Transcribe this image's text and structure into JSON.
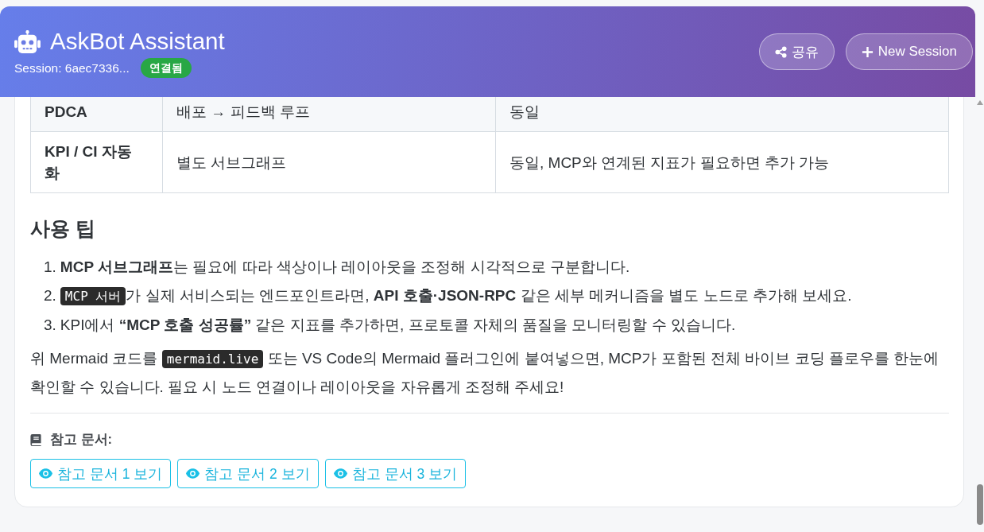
{
  "header": {
    "title": "AskBot Assistant",
    "session": "Session: 6aec7336...",
    "status_badge": {
      "label": "연결됨",
      "connected": true
    },
    "buttons": [
      {
        "kind": "share",
        "label": "공유"
      },
      {
        "kind": "new",
        "label": "New Session"
      }
    ]
  },
  "message": {
    "table": {
      "rows": [
        {
          "cells": [
            "PDCA",
            "배포 → 피드백 루프",
            "동일"
          ]
        },
        {
          "cells": [
            "KPI / CI 자동화",
            "별도 서브그래프",
            "동일, MCP와 연계된 지표가 필요하면 추가 가능"
          ]
        }
      ]
    },
    "heading": "사용 팁",
    "tips": [
      {
        "number": "1.",
        "segments": [
          {
            "kind": "text",
            "text": "**MCP 서브그래프**는 필요에 따라 색상이나 레이아웃을 조정해 시각적으로 구분합니다."
          }
        ]
      },
      {
        "number": "2.",
        "segments": [
          {
            "kind": "code",
            "text": "MCP 서버"
          },
          {
            "kind": "text",
            "text": "가 실제 서비스되는 엔드포인트라면, **API 호출·JSON-RPC** 같은 세부 메커니즘을 별도 노드로 추가해 보세요."
          }
        ]
      },
      {
        "number": "3.",
        "segments": [
          {
            "kind": "text",
            "text": "KPI에서 **“MCP 호출 성공률”** 같은 지표를 추가하면, 프로토콜 자체의 품질을 모니터링할 수 있습니다."
          }
        ]
      }
    ],
    "paragraph": [
      {
        "kind": "text",
        "text": "위 Mermaid 코드를 "
      },
      {
        "kind": "code",
        "text": "mermaid.live"
      },
      {
        "kind": "text",
        "text": " 또는 VS Code의 Mermaid 플러그인에 붙여넣으면, MCP가 포함된 전체 바이브 코딩 플로우를 한눈에 확인할 수 있습니다. 필요 시 노드 연결이나 레이아웃을 자유롭게 조정해 주세요!"
      }
    ],
    "references": {
      "label": "참고 문서:",
      "buttons": [
        "참고 문서 1 보기",
        "참고 문서 2 보기",
        "참고 문서 3 보기"
      ]
    }
  }
}
